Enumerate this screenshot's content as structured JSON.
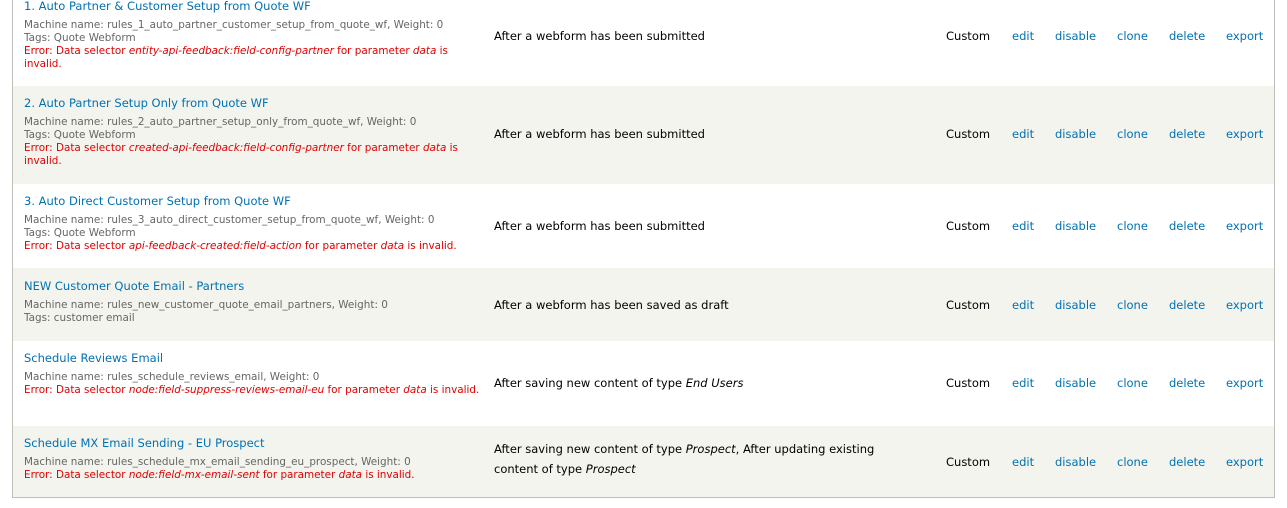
{
  "colors": {
    "link": "#0071b3",
    "error": "#e10000",
    "row_alt": "#f3f4ee"
  },
  "rules": [
    {
      "title": "1. Auto Partner & Customer Setup from Quote WF",
      "machine": "Machine name: rules_1_auto_partner_customer_setup_from_quote_wf, Weight: 0",
      "tags": "Tags: Quote Webform",
      "error": [
        {
          "t": "Error: Data selector "
        },
        {
          "t": "entity-api-feedback:field-config-partner",
          "i": true
        },
        {
          "t": " for parameter "
        },
        {
          "t": "data",
          "i": true
        },
        {
          "t": " is invalid."
        }
      ],
      "event": [
        {
          "t": "After a webform has been submitted"
        }
      ],
      "status": "Custom"
    },
    {
      "title": "2. Auto Partner Setup Only from Quote WF",
      "machine": "Machine name: rules_2_auto_partner_setup_only_from_quote_wf, Weight: 0",
      "tags": "Tags: Quote Webform",
      "error": [
        {
          "t": "Error: Data selector "
        },
        {
          "t": "created-api-feedback:field-config-partner",
          "i": true
        },
        {
          "t": " for parameter "
        },
        {
          "t": "data",
          "i": true
        },
        {
          "t": " is invalid."
        }
      ],
      "event": [
        {
          "t": "After a webform has been submitted"
        }
      ],
      "status": "Custom"
    },
    {
      "title": "3. Auto Direct Customer Setup from Quote WF",
      "machine": "Machine name: rules_3_auto_direct_customer_setup_from_quote_wf, Weight: 0",
      "tags": "Tags: Quote Webform",
      "error": [
        {
          "t": "Error: Data selector "
        },
        {
          "t": "api-feedback-created:field-action",
          "i": true
        },
        {
          "t": " for parameter "
        },
        {
          "t": "data",
          "i": true
        },
        {
          "t": " is invalid."
        }
      ],
      "event": [
        {
          "t": "After a webform has been submitted"
        }
      ],
      "status": "Custom"
    },
    {
      "title": "NEW Customer Quote Email - Partners",
      "machine": "Machine name: rules_new_customer_quote_email_partners, Weight: 0",
      "tags": "Tags: customer email",
      "error": null,
      "event": [
        {
          "t": "After a webform has been saved as draft"
        }
      ],
      "status": "Custom"
    },
    {
      "title": "Schedule Reviews Email",
      "machine": "Machine name: rules_schedule_reviews_email, Weight: 0",
      "tags": null,
      "error": [
        {
          "t": "Error: Data selector "
        },
        {
          "t": "node:field-suppress-reviews-email-eu",
          "i": true
        },
        {
          "t": " for parameter "
        },
        {
          "t": "data",
          "i": true
        },
        {
          "t": " is invalid."
        }
      ],
      "event": [
        {
          "t": "After saving new content of type "
        },
        {
          "t": "End Users",
          "i": true
        }
      ],
      "status": "Custom"
    },
    {
      "title": "Schedule MX Email Sending - EU Prospect",
      "machine": "Machine name: rules_schedule_mx_email_sending_eu_prospect, Weight: 0",
      "tags": null,
      "error": [
        {
          "t": "Error: Data selector "
        },
        {
          "t": "node:field-mx-email-sent",
          "i": true
        },
        {
          "t": " for parameter "
        },
        {
          "t": "data",
          "i": true
        },
        {
          "t": " is invalid."
        }
      ],
      "event": [
        {
          "t": "After saving new content of type "
        },
        {
          "t": "Prospect",
          "i": true
        },
        {
          "t": ", After updating existing content of type "
        },
        {
          "t": "Prospect",
          "i": true
        }
      ],
      "status": "Custom"
    }
  ],
  "operations": [
    "edit",
    "disable",
    "clone",
    "delete",
    "export"
  ]
}
